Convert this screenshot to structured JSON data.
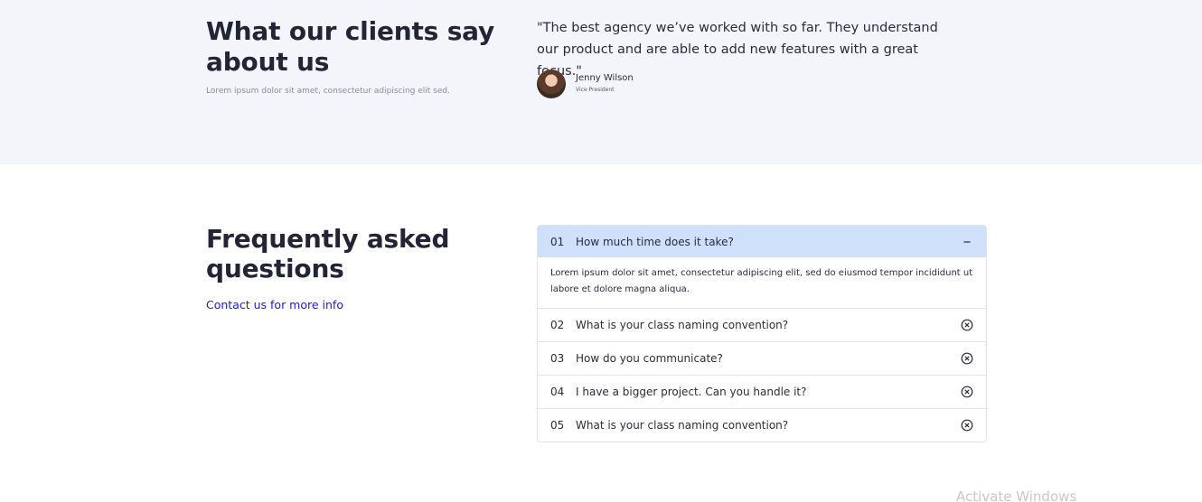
{
  "testimonials": {
    "heading": "What our clients say about us",
    "subtext": "Lorem ipsum dolor sit amet, consectetur adipiscing elit sed.",
    "quote": "\"The best agency we’ve worked with so far. They understand our product and are able to add new features with a great focus.\"",
    "author_name": "Jenny Wilson",
    "author_role": "Vice President"
  },
  "faq": {
    "heading": "Frequently asked questions",
    "contact_link": "Contact us for more info",
    "items": [
      {
        "num": "01",
        "question": "How much time does it take?",
        "answer": "Lorem ipsum dolor sit amet, consectetur adipiscing elit, sed do eiusmod tempor incididunt ut labore et dolore magna aliqua.",
        "open": true
      },
      {
        "num": "02",
        "question": "What is your class naming convention?",
        "open": false
      },
      {
        "num": "03",
        "question": "How do you communicate?",
        "open": false
      },
      {
        "num": "04",
        "question": "I have a bigger project. Can you handle it?",
        "open": false
      },
      {
        "num": "05",
        "question": "What is your class naming convention?",
        "open": false
      }
    ]
  },
  "watermark": "Activate Windows"
}
